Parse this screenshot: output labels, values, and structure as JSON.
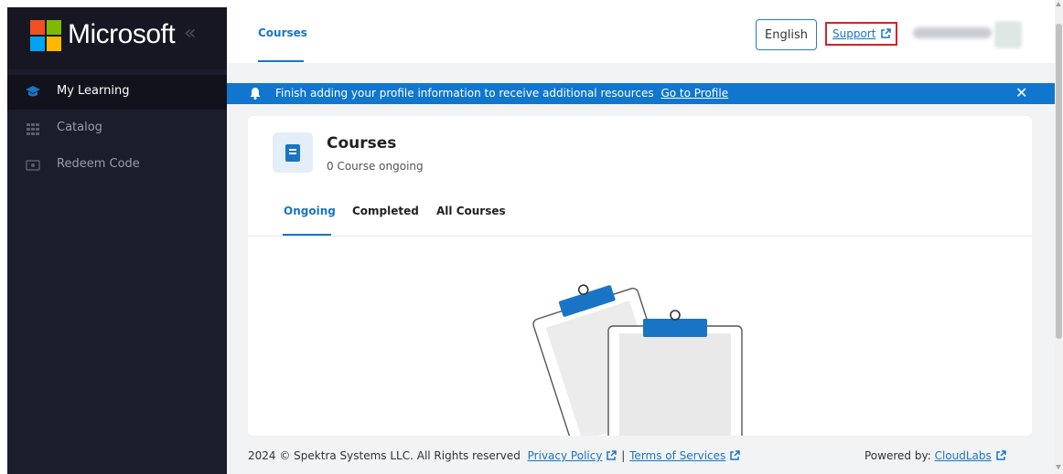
{
  "sidebar": {
    "brand_name": "Microsoft",
    "collapse_glyph": "«",
    "items": [
      {
        "label": "My Learning",
        "icon": "graduation-cap-icon",
        "active": true
      },
      {
        "label": "Catalog",
        "icon": "grid-icon",
        "active": false
      },
      {
        "label": "Redeem Code",
        "icon": "ticket-icon",
        "active": false
      }
    ]
  },
  "topbar": {
    "tab_label": "Courses",
    "language_label": "English",
    "support_label": "Support"
  },
  "banner": {
    "message": "Finish adding your profile information to receive additional resources",
    "link_label": "Go to Profile",
    "close_glyph": "✕"
  },
  "card": {
    "title": "Courses",
    "subtitle": "0 Course ongoing",
    "tabs": [
      "Ongoing",
      "Completed",
      "All Courses"
    ]
  },
  "footer": {
    "copyright": "2024 © Spektra Systems LLC. All Rights reserved",
    "privacy_label": "Privacy Policy",
    "separator": "|",
    "terms_label": "Terms of Services",
    "powered_prefix": "Powered by:",
    "powered_link": "CloudLabs"
  },
  "colors": {
    "sidebar_bg": "#1c1d2b",
    "accent": "#1a74c5",
    "banner_bg": "#1176cd",
    "support_border": "#d0242b",
    "ms_red": "#f25022",
    "ms_green": "#7fba00",
    "ms_blue": "#00a4ef",
    "ms_yellow": "#ffb900"
  }
}
